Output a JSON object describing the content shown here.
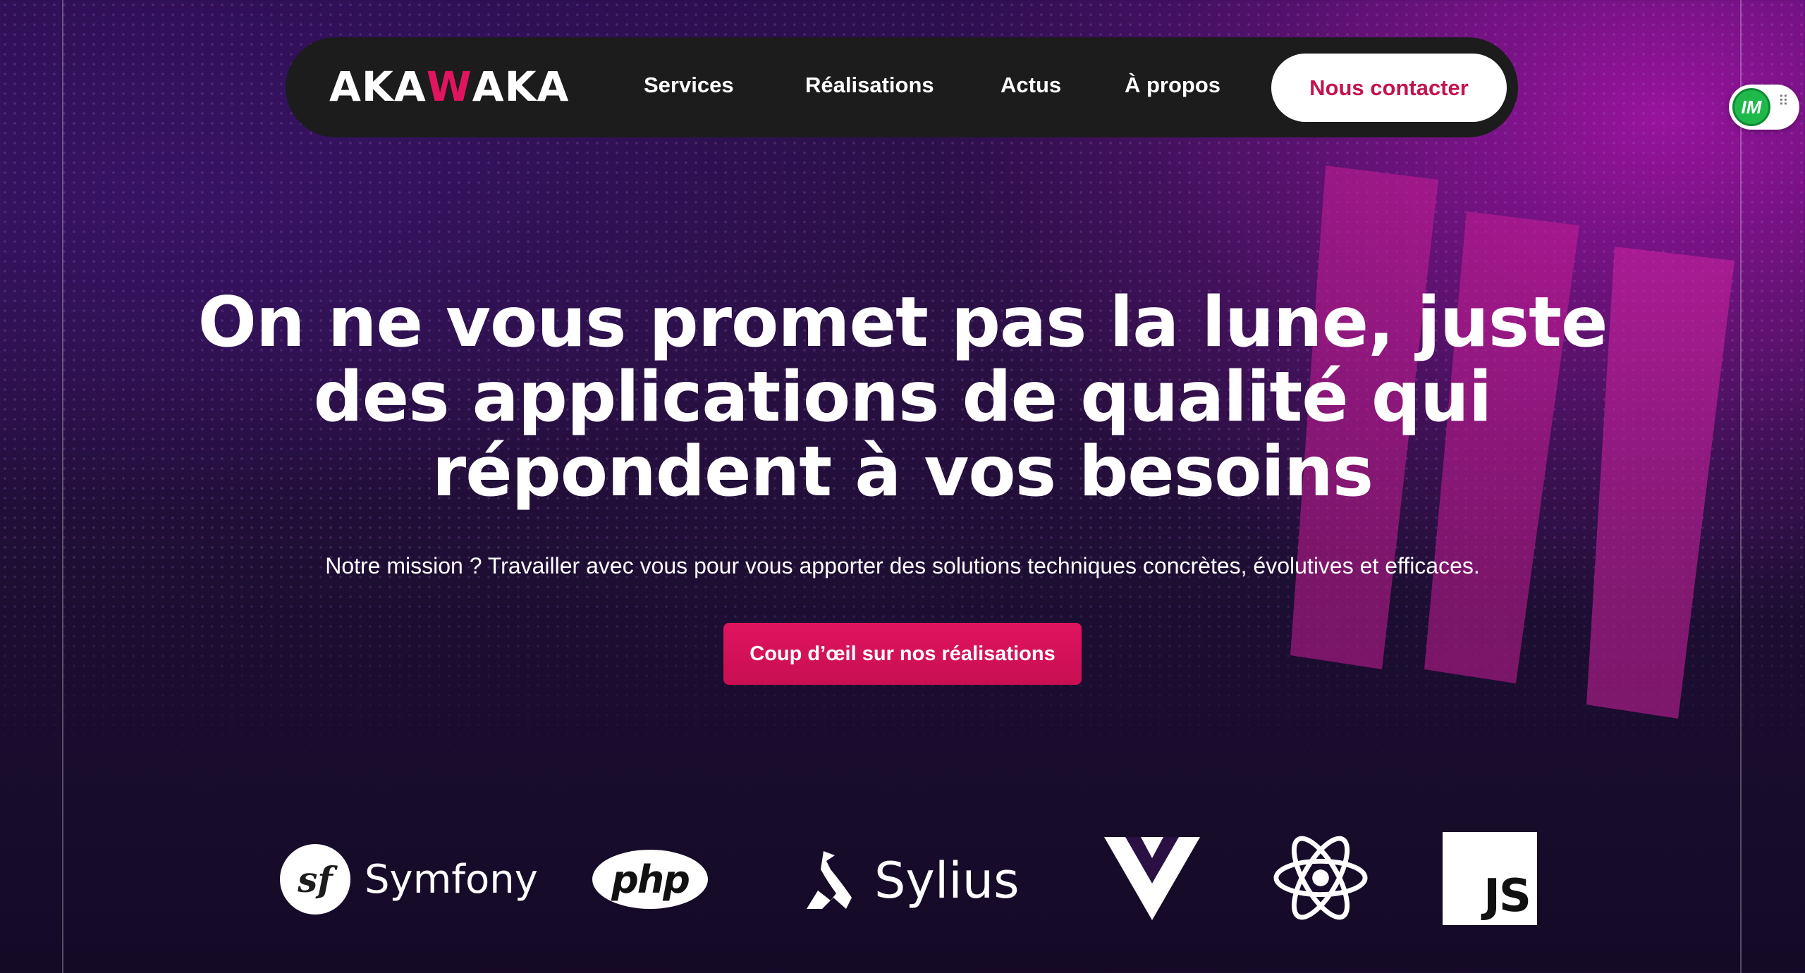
{
  "brand": {
    "logo_prefix": "AKA",
    "logo_accent": "W",
    "logo_suffix": "AKA"
  },
  "nav": {
    "items": [
      {
        "label": "Services"
      },
      {
        "label": "Réalisations"
      },
      {
        "label": "Actus"
      },
      {
        "label": "À propos"
      }
    ],
    "contact_label": "Nous contacter"
  },
  "extension": {
    "badge": "IM"
  },
  "hero": {
    "title": "On ne vous promet pas la lune, juste des applications de qualité qui répondent à vos besoins",
    "subtitle": "Notre mission ? Travailler avec vous pour vous apporter des solutions techniques concrètes, évolutives et efficaces.",
    "cta_label": "Coup d’œil sur nos réalisations"
  },
  "technologies": [
    {
      "name": "Symfony",
      "mark": "sf",
      "icon": "symfony-icon"
    },
    {
      "name": "php",
      "icon": "php-icon"
    },
    {
      "name": "Sylius",
      "icon": "sylius-icon"
    },
    {
      "name": "Vue",
      "icon": "vue-icon"
    },
    {
      "name": "React",
      "icon": "react-icon"
    },
    {
      "name": "JS",
      "icon": "javascript-icon"
    }
  ],
  "colors": {
    "accent": "#e0145f",
    "nav_bg": "#1c1c1c",
    "bg_top": "#2c0f4f",
    "bg_bottom": "#140a26"
  }
}
